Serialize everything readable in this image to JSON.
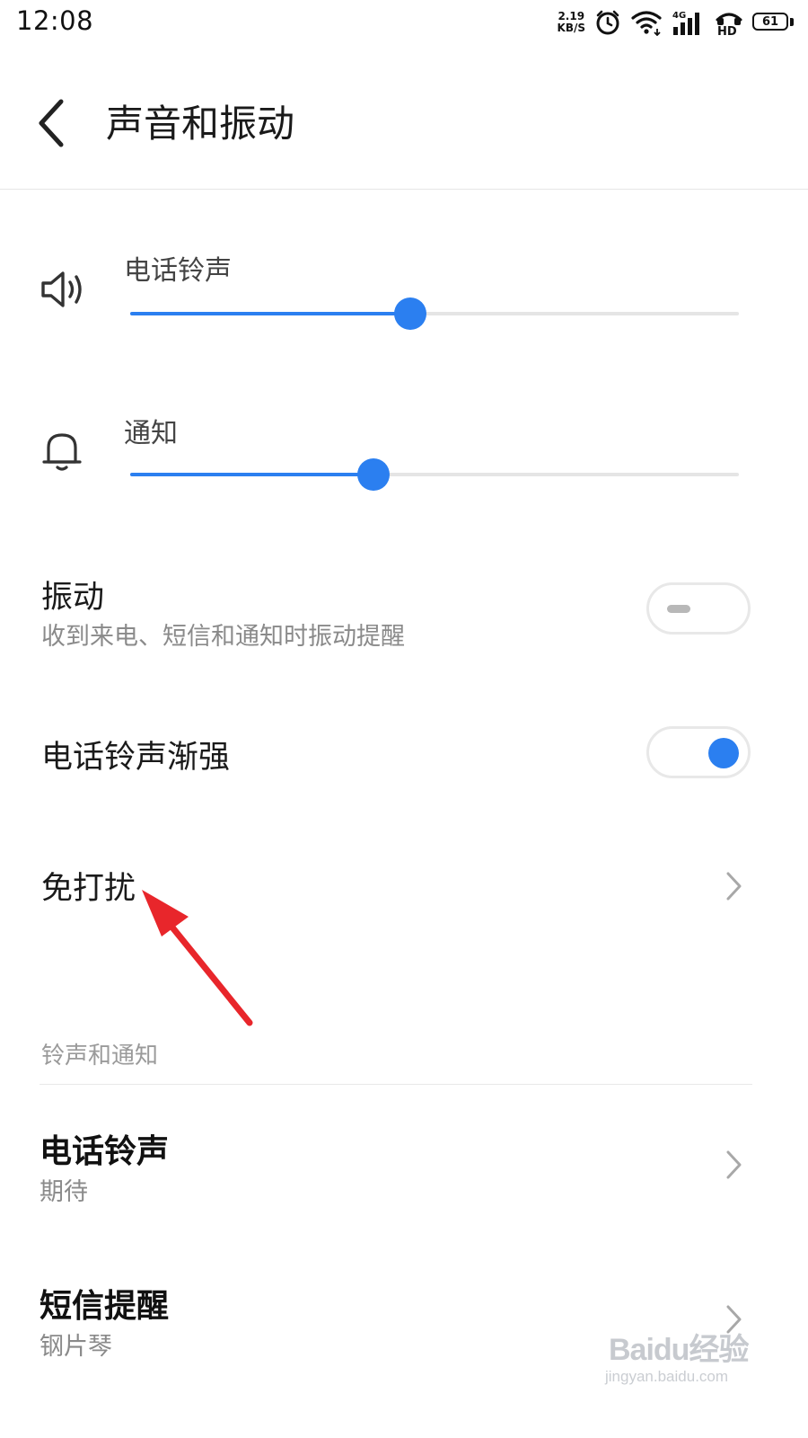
{
  "status_bar": {
    "time": "12:08",
    "net_speed_value": "2.19",
    "net_speed_unit": "KB/S",
    "network_type": "4G",
    "hd_label": "HD",
    "battery_level": "61",
    "icons": [
      "alarm-icon",
      "wifi-icon",
      "signal-icon",
      "hd-call-icon",
      "battery-icon"
    ]
  },
  "header": {
    "back_icon": "chevron-left-icon",
    "title": "声音和振动"
  },
  "volumes": [
    {
      "label": "电话铃声",
      "icon": "speaker-icon",
      "level_percent": 46
    },
    {
      "label": "通知",
      "icon": "bell-icon",
      "level_percent": 40
    }
  ],
  "toggles": [
    {
      "title": "振动",
      "subtitle": "收到来电、短信和通知时振动提醒",
      "enabled": false
    },
    {
      "title": "电话铃声渐强",
      "enabled": true
    }
  ],
  "dnd": {
    "label": "免打扰",
    "icon": "chevron-right-icon"
  },
  "section": {
    "header": "铃声和通知",
    "items": [
      {
        "title": "电话铃声",
        "value": "期待"
      },
      {
        "title": "短信提醒",
        "value": "钢片琴"
      }
    ]
  },
  "watermark": {
    "brand": "Baidu经验",
    "url": "jingyan.baidu.com"
  },
  "colors": {
    "accent": "#2b7ff0",
    "annotation_arrow": "#e8262b",
    "secondary_text": "#8a8a8a"
  }
}
